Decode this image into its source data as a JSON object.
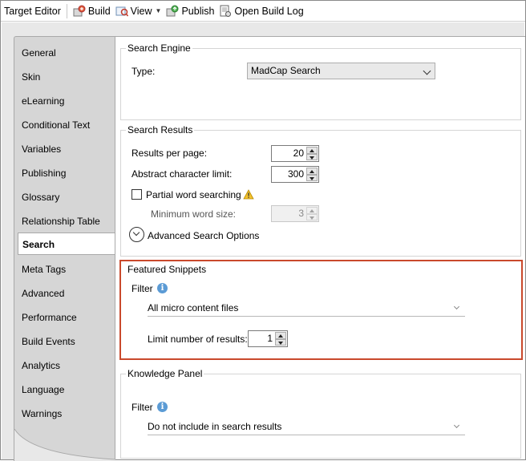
{
  "toolbar": {
    "target_editor": "Target Editor",
    "build": "Build",
    "view": "View",
    "publish": "Publish",
    "open_build_log": "Open Build Log"
  },
  "sidebar": {
    "items": [
      {
        "label": "General"
      },
      {
        "label": "Skin"
      },
      {
        "label": "eLearning"
      },
      {
        "label": "Conditional Text"
      },
      {
        "label": "Variables"
      },
      {
        "label": "Publishing"
      },
      {
        "label": "Glossary"
      },
      {
        "label": "Relationship Table"
      },
      {
        "label": "Search"
      },
      {
        "label": "Meta Tags"
      },
      {
        "label": "Advanced"
      },
      {
        "label": "Performance"
      },
      {
        "label": "Build Events"
      },
      {
        "label": "Analytics"
      },
      {
        "label": "Language"
      },
      {
        "label": "Warnings"
      }
    ],
    "active": "Search"
  },
  "search_engine": {
    "title": "Search Engine",
    "type_label": "Type:",
    "type_value": "MadCap Search"
  },
  "search_results": {
    "title": "Search Results",
    "results_per_page_label": "Results per page:",
    "results_per_page_value": "20",
    "abstract_limit_label": "Abstract character limit:",
    "abstract_limit_value": "300",
    "partial_word_label": "Partial word searching",
    "partial_word_checked": false,
    "min_word_size_label": "Minimum word size:",
    "min_word_size_value": "3",
    "advanced_options_label": "Advanced Search Options"
  },
  "featured_snippets": {
    "title": "Featured Snippets",
    "filter_label": "Filter",
    "filter_value": "All micro content files",
    "limit_label": "Limit number of results:",
    "limit_value": "1"
  },
  "knowledge_panel": {
    "title": "Knowledge Panel",
    "filter_label": "Filter",
    "filter_value": "Do not include in search results"
  },
  "colors": {
    "highlight": "#c9492c",
    "info": "#5b9bd5",
    "warning": "#f2c12e"
  }
}
